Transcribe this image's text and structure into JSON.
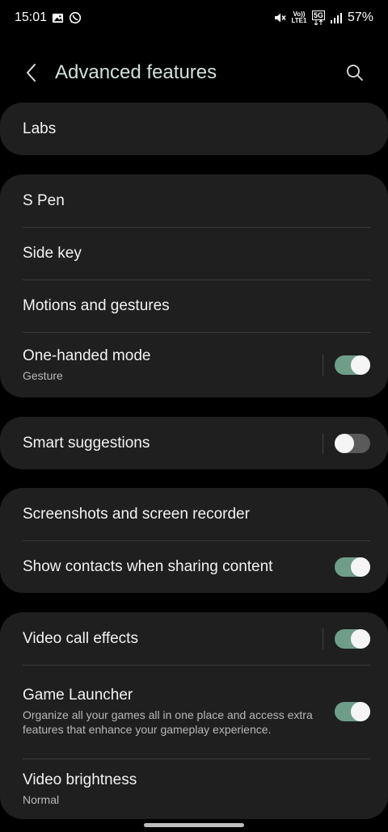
{
  "status_bar": {
    "time": "15:01",
    "left_icons": [
      "gallery-icon",
      "whatsapp-icon"
    ],
    "right_icons": [
      "mute-icon",
      "volte-icon",
      "5g-icon",
      "signal-icon"
    ],
    "volte_label": "Vo)) LTE1",
    "network_label": "5G",
    "battery": "57%"
  },
  "header": {
    "title": "Advanced features"
  },
  "groups": [
    {
      "items": [
        {
          "title": "Labs"
        }
      ]
    },
    {
      "items": [
        {
          "title": "S Pen"
        },
        {
          "title": "Side key"
        },
        {
          "title": "Motions and gestures"
        },
        {
          "title": "One-handed mode",
          "subtitle": "Gesture",
          "toggle": "on"
        }
      ]
    },
    {
      "items": [
        {
          "title": "Smart suggestions",
          "toggle": "off"
        }
      ]
    },
    {
      "items": [
        {
          "title": "Screenshots and screen recorder"
        },
        {
          "title": "Show contacts when sharing content",
          "toggle": "on"
        }
      ]
    },
    {
      "items": [
        {
          "title": "Video call effects",
          "toggle": "on"
        },
        {
          "title": "Game Launcher",
          "subtitle": "Organize all your games all in one place and access extra features that enhance your gameplay experience.",
          "toggle": "on"
        },
        {
          "title": "Video brightness",
          "subtitle": "Normal"
        }
      ]
    }
  ],
  "colors": {
    "toggle_on": "#6e9e8a",
    "toggle_off": "#5a5a5a",
    "card_bg": "#1f1f1f",
    "title_accent": "#cfe1d8"
  }
}
